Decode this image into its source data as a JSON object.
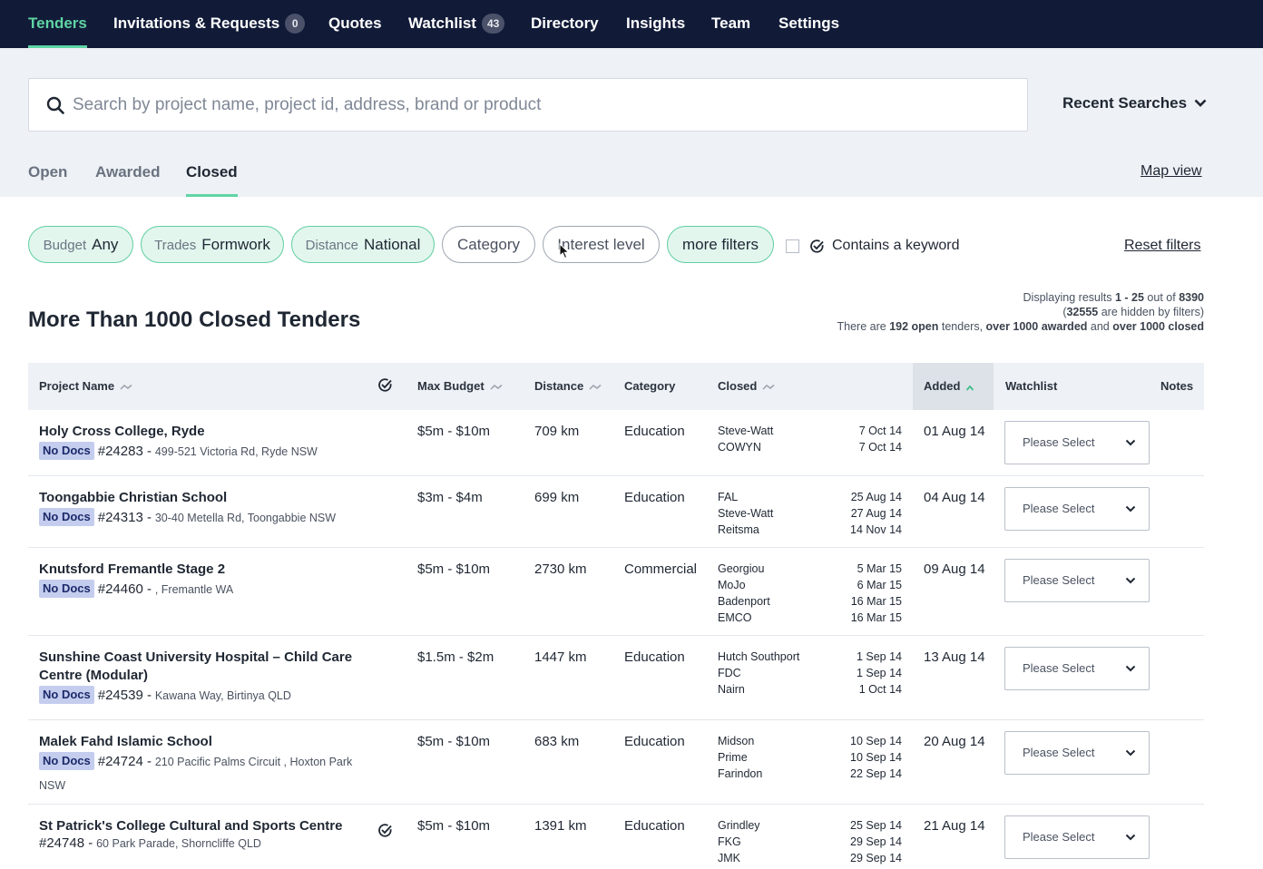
{
  "nav": {
    "items": [
      {
        "label": "Tenders",
        "badge": ""
      },
      {
        "label": "Invitations & Requests",
        "badge": "0"
      },
      {
        "label": "Quotes",
        "badge": ""
      },
      {
        "label": "Watchlist",
        "badge": "43"
      },
      {
        "label": "Directory",
        "badge": ""
      },
      {
        "label": "Insights",
        "badge": ""
      },
      {
        "label": "Team",
        "badge": ""
      },
      {
        "label": "Settings",
        "badge": ""
      }
    ],
    "active": "Tenders"
  },
  "search": {
    "placeholder": "Search by project name, project id, address, brand or product",
    "recent_label": "Recent Searches"
  },
  "status_tabs": {
    "open": "Open",
    "awarded": "Awarded",
    "closed": "Closed",
    "active": "Closed",
    "map_view": "Map view"
  },
  "filters": {
    "budget": {
      "key": "Budget",
      "value": "Any"
    },
    "trades": {
      "key": "Trades",
      "value": "Formwork"
    },
    "distance": {
      "key": "Distance",
      "value": "National"
    },
    "category": "Category",
    "interest": "Interest level",
    "more": "more filters",
    "keyword_label": "Contains a keyword",
    "reset": "Reset filters"
  },
  "results": {
    "displaying": "Displaying results",
    "range": "1 - 25",
    "out_of": "out of",
    "total": "8390",
    "hidden": "32555",
    "hidden_suffix": "are hidden by filters)",
    "there_are": "There are",
    "open_count": "192 open",
    "tenders": "tenders,",
    "awarded": "over 1000 awarded",
    "and": "and",
    "closed": "over 1000 closed"
  },
  "heading": "More Than 1000 Closed Tenders",
  "table": {
    "headers": {
      "project": "Project Name",
      "budget": "Max Budget",
      "distance": "Distance",
      "category": "Category",
      "closed": "Closed",
      "added": "Added",
      "watchlist": "Watchlist",
      "notes": "Notes"
    },
    "no_docs_label": "No Docs",
    "select_placeholder": "Please Select",
    "rows": [
      {
        "name": "Holy Cross College, Ryde",
        "no_docs": true,
        "id": "#24283 -",
        "address": "499-521 Victoria Rd, Ryde NSW",
        "budget": "$5m - $10m",
        "distance": "709 km",
        "category": "Education",
        "closed": [
          {
            "builder": "Steve-Watt",
            "date": "7 Oct 14"
          },
          {
            "builder": "COWYN",
            "date": "7 Oct 14"
          }
        ],
        "added": "01 Aug 14",
        "checked": false
      },
      {
        "name": "Toongabbie Christian School",
        "no_docs": true,
        "id": "#24313 -",
        "address": "30-40 Metella Rd, Toongabbie NSW",
        "budget": "$3m - $4m",
        "distance": "699 km",
        "category": "Education",
        "closed": [
          {
            "builder": "FAL",
            "date": "25 Aug 14"
          },
          {
            "builder": "Steve-Watt",
            "date": "27 Aug 14"
          },
          {
            "builder": "Reitsma",
            "date": "14 Nov 14"
          }
        ],
        "added": "04 Aug 14",
        "checked": false
      },
      {
        "name": "Knutsford Fremantle Stage 2",
        "no_docs": true,
        "id": "#24460 -",
        "address": ", Fremantle WA",
        "budget": "$5m - $10m",
        "distance": "2730 km",
        "category": "Commercial",
        "closed": [
          {
            "builder": "Georgiou",
            "date": "5 Mar 15"
          },
          {
            "builder": "MoJo",
            "date": "6 Mar 15"
          },
          {
            "builder": "Badenport",
            "date": "16 Mar 15"
          },
          {
            "builder": "EMCO",
            "date": "16 Mar 15"
          }
        ],
        "added": "09 Aug 14",
        "checked": false
      },
      {
        "name": "Sunshine Coast University Hospital – Child Care Centre (Modular)",
        "no_docs": true,
        "id": "#24539 -",
        "address": "Kawana Way, Birtinya QLD",
        "budget": "$1.5m - $2m",
        "distance": "1447 km",
        "category": "Education",
        "closed": [
          {
            "builder": "Hutch Southport",
            "date": "1 Sep 14"
          },
          {
            "builder": "FDC",
            "date": "1 Sep 14"
          },
          {
            "builder": "Nairn",
            "date": "1 Oct 14"
          }
        ],
        "added": "13 Aug 14",
        "checked": false
      },
      {
        "name": "Malek Fahd Islamic School",
        "no_docs": true,
        "id": "#24724 -",
        "address": "210 Pacific Palms Circuit , Hoxton Park NSW",
        "budget": "$5m - $10m",
        "distance": "683 km",
        "category": "Education",
        "closed": [
          {
            "builder": "Midson",
            "date": "10 Sep 14"
          },
          {
            "builder": "Prime",
            "date": "10 Sep 14"
          },
          {
            "builder": "Farindon",
            "date": "22 Sep 14"
          }
        ],
        "added": "20 Aug 14",
        "checked": false
      },
      {
        "name": "St Patrick's College Cultural and Sports Centre",
        "no_docs": false,
        "id": "#24748 -",
        "address": "60 Park Parade, Shorncliffe QLD",
        "budget": "$5m - $10m",
        "distance": "1391 km",
        "category": "Education",
        "closed": [
          {
            "builder": "Grindley",
            "date": "25 Sep 14"
          },
          {
            "builder": "FKG",
            "date": "29 Sep 14"
          },
          {
            "builder": "JMK",
            "date": "29 Sep 14"
          }
        ],
        "added": "21 Aug 14",
        "checked": true
      }
    ]
  },
  "colors": {
    "nav_bg": "#111b38",
    "accent": "#5fd4a4",
    "chip_on_bg": "#e2f6ee",
    "no_docs_bg": "#c4cdee"
  }
}
